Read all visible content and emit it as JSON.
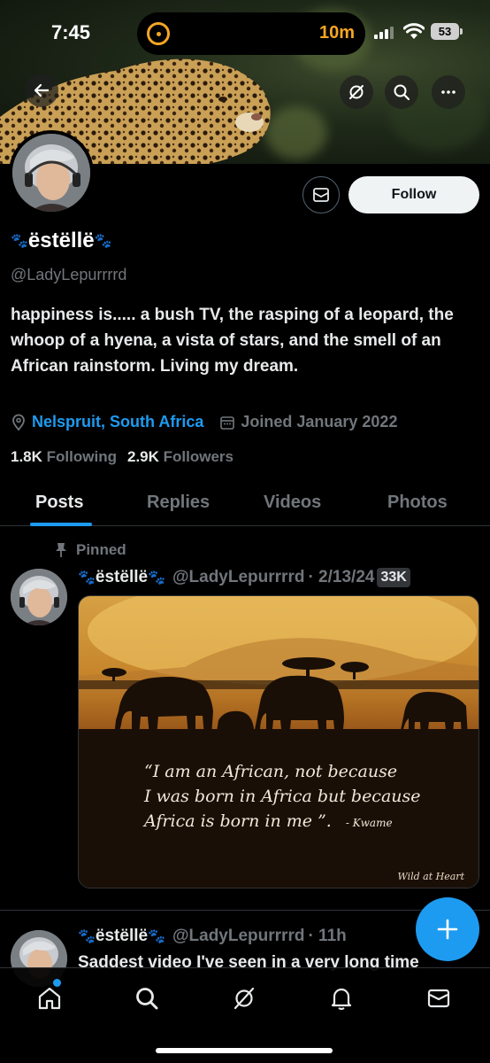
{
  "status_bar": {
    "time": "7:45",
    "timer": "10m",
    "battery": "53"
  },
  "profile": {
    "display_name": "ëstëllë",
    "handle": "@LadyLepurrrrd",
    "bio": "happiness is..... a bush TV, the rasping of a leopard, the whoop of a hyena, a vista of stars, and the smell of an African rainstorm. Living my dream.",
    "location": "Nelspruit, South Africa",
    "joined": "Joined January 2022",
    "following_count": "1.8K",
    "following_label": "Following",
    "followers_count": "2.9K",
    "followers_label": "Followers",
    "follow_label": "Follow"
  },
  "tabs": [
    {
      "label": "Posts"
    },
    {
      "label": "Replies"
    },
    {
      "label": "Videos"
    },
    {
      "label": "Photos"
    }
  ],
  "posts": [
    {
      "pinned_label": "Pinned",
      "author": "ëstëllë",
      "handle": "@LadyLepurrrrd",
      "date": "· 2/13/24",
      "views": "33K",
      "image": {
        "quote_line1": "“I am an African, not because",
        "quote_line2": "I was born in Africa but because",
        "quote_line3": "Africa is born in me ”.",
        "quote_author": "- Kwame",
        "watermark": "Wild at Heart"
      }
    },
    {
      "author": "ëstëllë",
      "handle": "@LadyLepurrrrd",
      "date": "· 11h",
      "text": "Saddest video I've seen in a very long time"
    }
  ],
  "colors": {
    "accent": "#1d9bf0",
    "background": "#000000",
    "muted": "#71767b"
  },
  "icons": [
    "back-arrow-icon",
    "grok-icon",
    "search-icon",
    "more-icon",
    "mail-icon",
    "location-icon",
    "calendar-icon",
    "pin-icon",
    "plus-icon",
    "home-icon",
    "explore-icon",
    "grok-nav-icon",
    "bell-icon",
    "messages-icon"
  ]
}
